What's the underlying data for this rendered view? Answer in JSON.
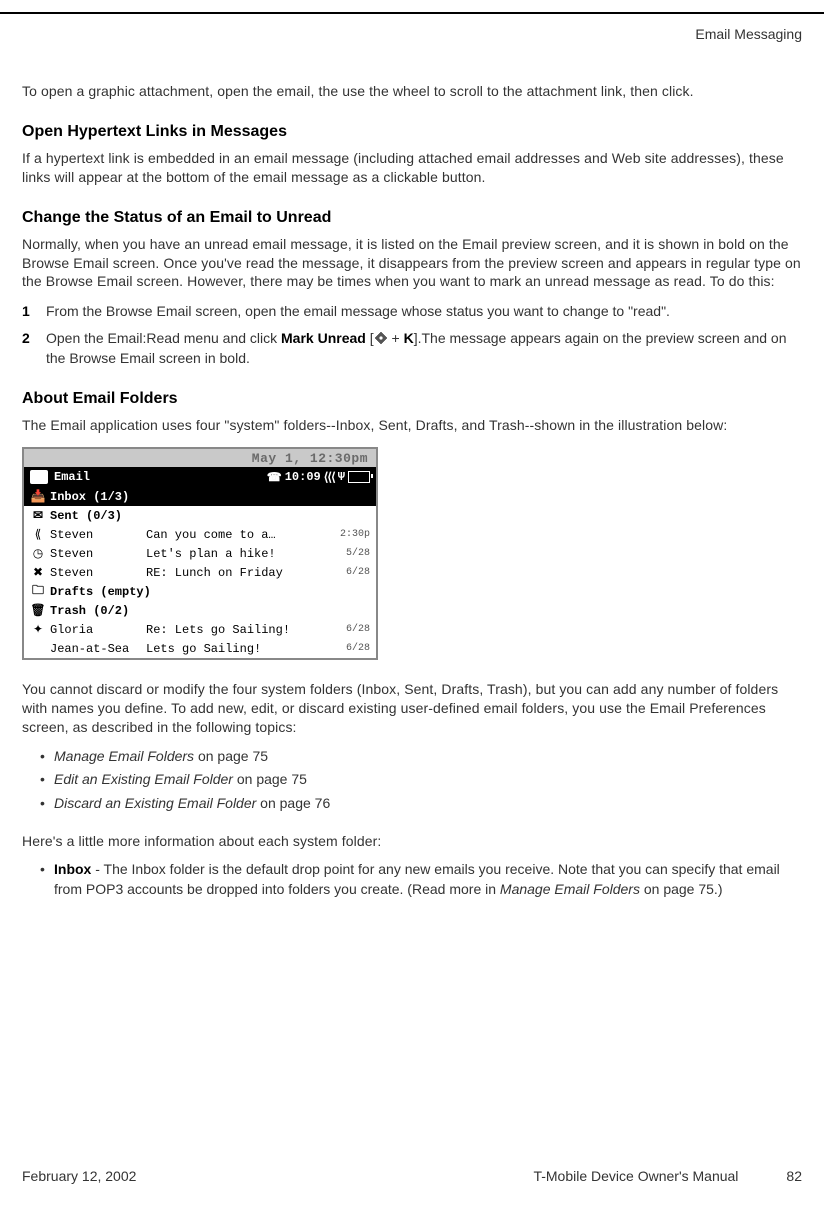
{
  "header": {
    "section_label": "Email Messaging"
  },
  "intro": "To open a graphic attachment, open the email, the use the wheel to scroll to the attachment link, then click.",
  "s1": {
    "heading": "Open Hypertext Links in Messages",
    "p1": "If a hypertext link is embedded in an email message (including attached email addresses and Web site addresses), these links will appear at the bottom of the email message as a clickable button."
  },
  "s2": {
    "heading": "Change the Status of an Email to Unread",
    "p1": "Normally, when you have an unread email message, it is listed on the Email preview screen, and it is shown in bold on the Browse Email screen. Once you've read the message, it disappears from the preview screen and appears in regular type on the Browse Email screen. However, there may be times when you want to mark an unread message as read. To do this:",
    "li1": "From the Browse Email screen, open the email message whose status you want to change to \"read\".",
    "li2_a": "Open the Email:Read menu and click ",
    "li2_bold": "Mark Unread",
    "li2_b": " [",
    "li2_c": " + ",
    "li2_kbold": "K",
    "li2_d": "].The message appears again on the preview screen and on the Browse Email screen in bold."
  },
  "s3": {
    "heading": "About Email Folders",
    "p1": "The Email application uses four \"system\" folders--Inbox, Sent, Drafts, and Trash--shown in the illustration below:"
  },
  "device": {
    "date_time": "May 1, 12:30pm",
    "app_title": "Email",
    "clock": "10:09",
    "inbox_label": "Inbox (1/3)",
    "sent_label": "Sent (0/3)",
    "drafts_label": "Drafts (empty)",
    "trash_label": "Trash (0/2)",
    "rows": {
      "r1": {
        "sender": "Steven",
        "subject": "Can you come to a…",
        "time": "2:30p"
      },
      "r2": {
        "sender": "Steven",
        "subject": "Let's plan a hike!",
        "time": "5/28"
      },
      "r3": {
        "sender": "Steven",
        "subject": "RE: Lunch on Friday",
        "time": "6/28"
      },
      "r4": {
        "sender": "Gloria",
        "subject": "Re: Lets go Sailing!",
        "time": "6/28"
      },
      "r5": {
        "sender": "Jean-at-Sea",
        "subject": "Lets go Sailing!",
        "time": "6/28"
      }
    }
  },
  "after_device": {
    "p1": "You cannot discard or modify the four system folders (Inbox, Sent, Drafts, Trash), but you can add any number of folders with names you define. To add new, edit, or discard existing user-defined email folders, you use the Email Preferences screen, as described in the following topics:",
    "b1_i": "Manage Email Folders",
    "b1_r": " on page 75",
    "b2_i": "Edit an Existing Email Folder",
    "b2_r": " on page 75",
    "b3_i": "Discard an Existing Email Folder",
    "b3_r": " on page 76",
    "p2": "Here's a little more information about each system folder:",
    "inbox_label": "Inbox",
    "inbox_a": " - The Inbox folder is the default drop point for any new emails you receive. Note that you can specify that email from POP3 accounts be dropped into folders you create. (Read more in ",
    "inbox_i": "Manage Email Folders",
    "inbox_b": " on page 75.)"
  },
  "footer": {
    "date": "February 12, 2002",
    "manual": "T-Mobile Device Owner's Manual",
    "page": "82"
  }
}
